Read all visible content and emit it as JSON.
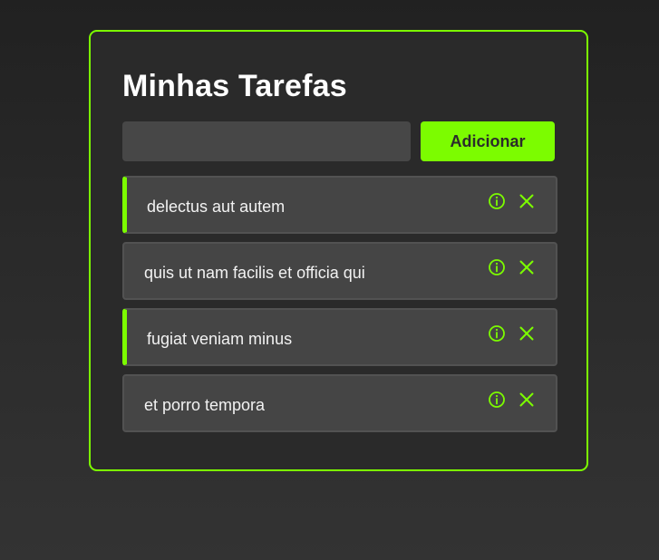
{
  "app": {
    "title": "Minhas Tarefas",
    "accent_color": "#7CFC00"
  },
  "form": {
    "input_value": "",
    "input_placeholder": "",
    "add_label": "Adicionar"
  },
  "tasks": [
    {
      "text": "delectus aut autem",
      "completed": true,
      "info_icon": "info-icon",
      "delete_icon": "close-icon"
    },
    {
      "text": "quis ut nam facilis et officia qui",
      "completed": false,
      "info_icon": "info-icon",
      "delete_icon": "close-icon"
    },
    {
      "text": "fugiat veniam minus",
      "completed": true,
      "info_icon": "info-icon",
      "delete_icon": "close-icon"
    },
    {
      "text": "et porro tempora",
      "completed": false,
      "info_icon": "info-icon",
      "delete_icon": "close-icon"
    }
  ]
}
